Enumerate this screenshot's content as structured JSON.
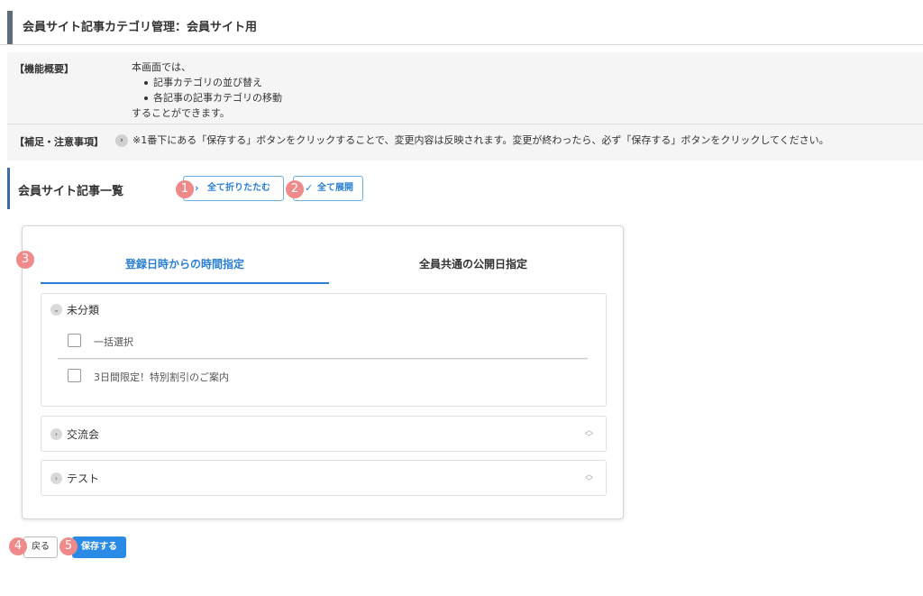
{
  "page": {
    "title": "会員サイト記事カテゴリ管理：会員サイト用"
  },
  "info": {
    "overview_label": "【機能概要】",
    "overview_intro": "本画面では、",
    "overview_items": [
      "記事カテゴリの並び替え",
      "各記事の記事カテゴリの移動"
    ],
    "overview_outro": "することができます。",
    "notes_label": "【補足・注意事項】",
    "notes_text": "※1番下にある「保存する」ボタンをクリックすることで、変更内容は反映されます。変更が終わったら、必ず「保存する」ボタンをクリックしてください。"
  },
  "section": {
    "title": "会員サイト記事一覧",
    "collapse_all_label": "全て折りたたむ",
    "expand_all_label": "全て展開"
  },
  "badges": [
    "1",
    "2",
    "3",
    "4",
    "5"
  ],
  "tabs": [
    {
      "label": "登録日時からの時間指定",
      "active": true
    },
    {
      "label": "全員共通の公開日指定",
      "active": false
    }
  ],
  "categories": [
    {
      "name": "未分類",
      "expanded": true,
      "select_all_label": "一括選択",
      "articles": [
        "3日間限定！特別割引のご案内"
      ]
    },
    {
      "name": "交流会",
      "expanded": false
    },
    {
      "name": "テスト",
      "expanded": false
    }
  ],
  "footer": {
    "back_label": "戻る",
    "save_label": "保存する"
  },
  "colors": {
    "accent_blue": "#2a7fd4",
    "badge_pink": "#f08a8a",
    "header_accent": "#5f6b78"
  },
  "icons": {
    "collapse_icon": "chevron-right-icon",
    "expand_icon": "check-icon",
    "accordion_open": "chevron-down-icon",
    "accordion_closed": "chevron-right-icon",
    "sort_handle": "sort-updown-icon"
  }
}
